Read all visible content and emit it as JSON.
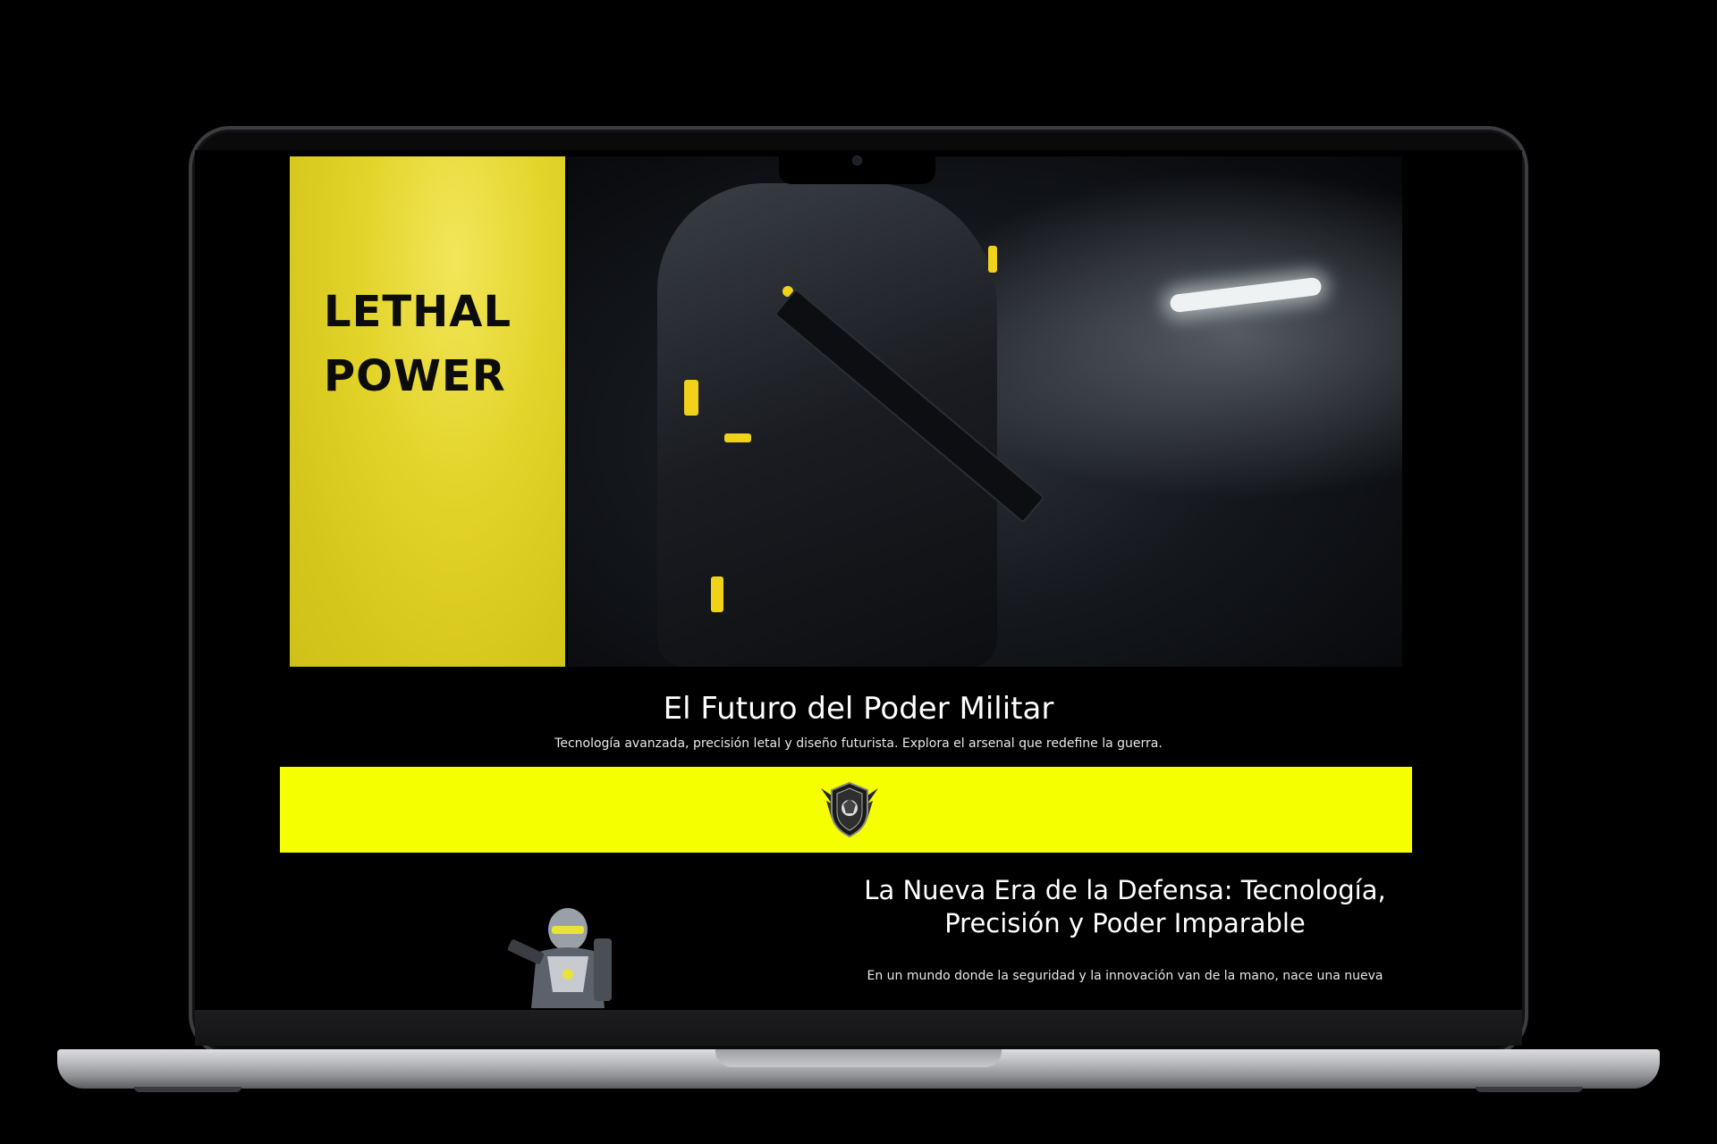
{
  "hero": {
    "title_line1": "LETHAL",
    "title_line2": "POWER"
  },
  "intro": {
    "title": "El Futuro del Poder Militar",
    "subtitle": "Tecnología avanzada, precisión letal y diseño futurista. Explora el arsenal que redefine la guerra."
  },
  "section2": {
    "heading_line1": "La Nueva Era de la Defensa: Tecnología,",
    "heading_line2": "Precisión y Poder Imparable",
    "body": "En un mundo donde la seguridad y la innovación van de la mano, nace una nueva"
  },
  "colors": {
    "banner": "#f5ff00",
    "hero_yellow": "#e3d42a",
    "background": "#000000"
  },
  "icons": [
    "emblem-icon",
    "soldier-image",
    "robot-soldier-image"
  ]
}
